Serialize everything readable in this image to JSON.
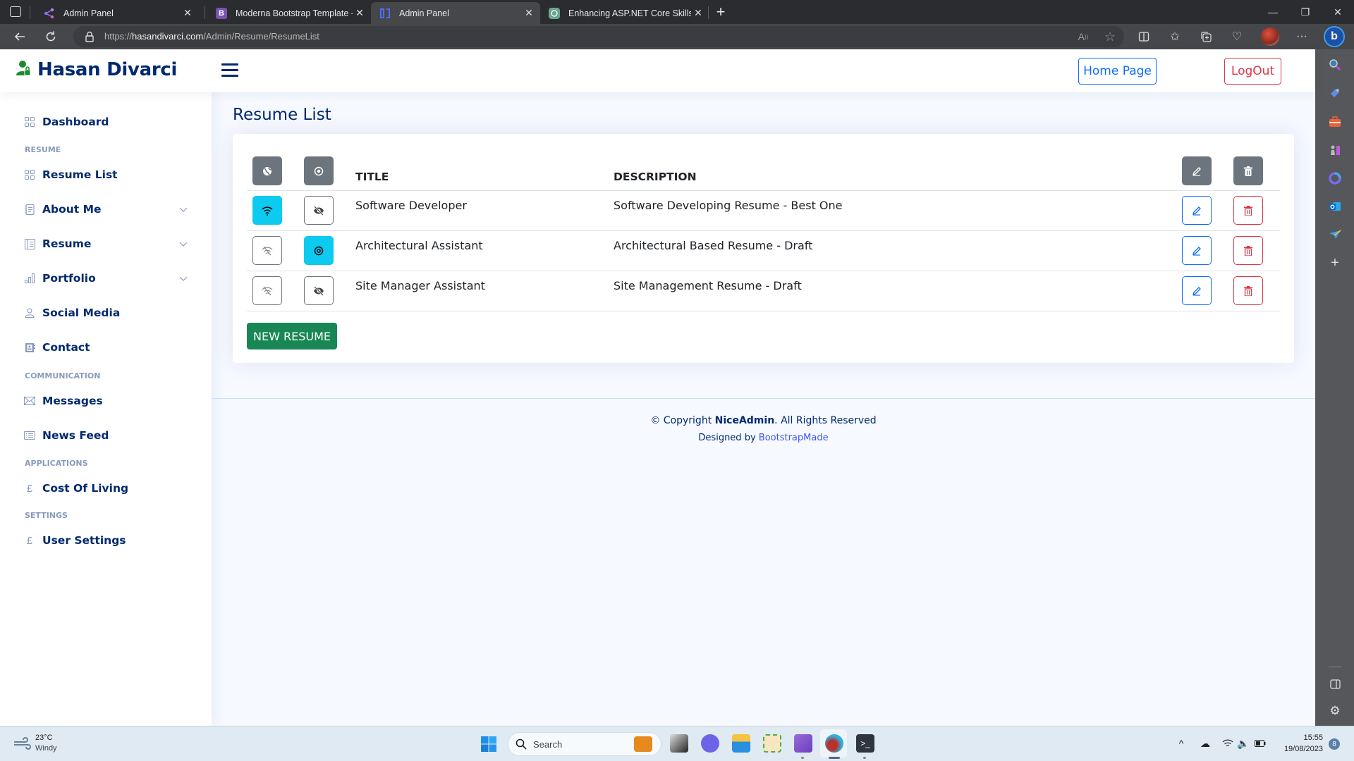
{
  "browser": {
    "tabs": [
      {
        "title": "Admin Panel",
        "icon": "share-node-icon",
        "active": false
      },
      {
        "title": "Moderna Bootstrap Template - In",
        "icon": "bootstrap-b-icon",
        "active": false
      },
      {
        "title": "Admin Panel",
        "icon": "laravel-bracket-icon",
        "active": true
      },
      {
        "title": "Enhancing ASP.NET Core Skills",
        "icon": "chatgpt-icon",
        "active": false
      }
    ],
    "new_tab_label": "+",
    "url_scheme": "https://",
    "url_host": "hasandivarci.com",
    "url_path": "/Admin/Resume/ResumeList",
    "window_controls": {
      "minimize": "—",
      "restore": "❐",
      "close": "✕"
    }
  },
  "header": {
    "brand": "Hasan Divarci",
    "home_button": "Home Page",
    "logout_button": "LogOut"
  },
  "sidebar": {
    "items": [
      {
        "label": "Dashboard",
        "icon": "grid-icon"
      },
      {
        "heading": "RESUME"
      },
      {
        "label": "Resume List",
        "icon": "grid-icon"
      },
      {
        "label": "About Me",
        "icon": "journal-text-icon",
        "expandable": true
      },
      {
        "label": "Resume",
        "icon": "layout-text-sidebar-icon",
        "expandable": true
      },
      {
        "label": "Portfolio",
        "icon": "bar-chart-icon",
        "expandable": true
      },
      {
        "label": "Social Media",
        "icon": "person-icon"
      },
      {
        "label": "Contact",
        "icon": "contact-card-icon"
      },
      {
        "heading": "COMMUNICATION"
      },
      {
        "label": "Messages",
        "icon": "envelope-icon"
      },
      {
        "label": "News Feed",
        "icon": "list-icon"
      },
      {
        "heading": "APPLICATIONS"
      },
      {
        "label": "Cost Of Living",
        "icon": "pound-icon"
      },
      {
        "heading": "SETTINGS"
      },
      {
        "label": "User Settings",
        "icon": "pound-icon"
      }
    ]
  },
  "main": {
    "page_title": "Resume List",
    "table": {
      "columns": [
        "TITLE",
        "DESCRIPTION"
      ],
      "header_icons": [
        "globe-icon",
        "eye-icon",
        "pencil-icon",
        "trash-icon"
      ],
      "rows": [
        {
          "title": "Software Developer",
          "description": "Software Developing Resume - Best One",
          "published": true,
          "visible": false
        },
        {
          "title": "Architectural Assistant",
          "description": "Architectural Based Resume - Draft",
          "published": false,
          "visible": true
        },
        {
          "title": "Site Manager Assistant",
          "description": "Site Management Resume - Draft",
          "published": false,
          "visible": false
        }
      ]
    },
    "new_button": "NEW RESUME"
  },
  "footer": {
    "copyright_prefix": "© Copyright ",
    "copyright_brand": "NiceAdmin",
    "copyright_suffix": ". All Rights Reserved",
    "designed_prefix": "Designed by ",
    "designed_link": "BootstrapMade"
  },
  "taskbar": {
    "weather_temp": "23°C",
    "weather_desc": "Windy",
    "search_placeholder": "Search",
    "time": "15:55",
    "date": "19/08/2023",
    "notification_count": "8"
  },
  "colors": {
    "brand_navy": "#012970",
    "brand_green": "#198754",
    "primary": "#0d6efd",
    "danger": "#dc3545",
    "active_cyan": "#0dcaf0",
    "secondary_gray": "#6c757d"
  }
}
